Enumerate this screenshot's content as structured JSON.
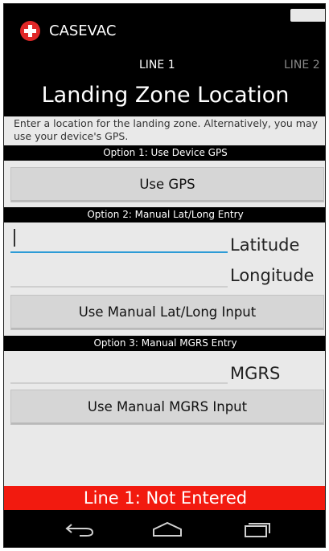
{
  "app": {
    "title": "CASEVAC",
    "icon": "red-cross-icon"
  },
  "tabs": [
    {
      "label": "LINE 1",
      "selected": true
    },
    {
      "label": "LINE 2",
      "selected": false
    }
  ],
  "screen_title": "Landing Zone Location",
  "intro_text": "Enter a location for the landing zone. Alternatively, you may use your device's GPS.",
  "option1": {
    "header": "Option 1: Use Device GPS",
    "button": "Use GPS"
  },
  "option2": {
    "header": "Option 2: Manual Lat/Long Entry",
    "latitude": {
      "value": "",
      "label": "Latitude"
    },
    "longitude": {
      "value": "",
      "label": "Longitude"
    },
    "button": "Use Manual Lat/Long Input"
  },
  "option3": {
    "header": "Option 3: Manual MGRS Entry",
    "mgrs": {
      "value": "",
      "label": "MGRS"
    },
    "button": "Use Manual MGRS Input"
  },
  "status": {
    "text": "Line 1: Not Entered",
    "color": "#f21a0f"
  },
  "navbar": [
    "back-icon",
    "home-icon",
    "recents-icon"
  ]
}
